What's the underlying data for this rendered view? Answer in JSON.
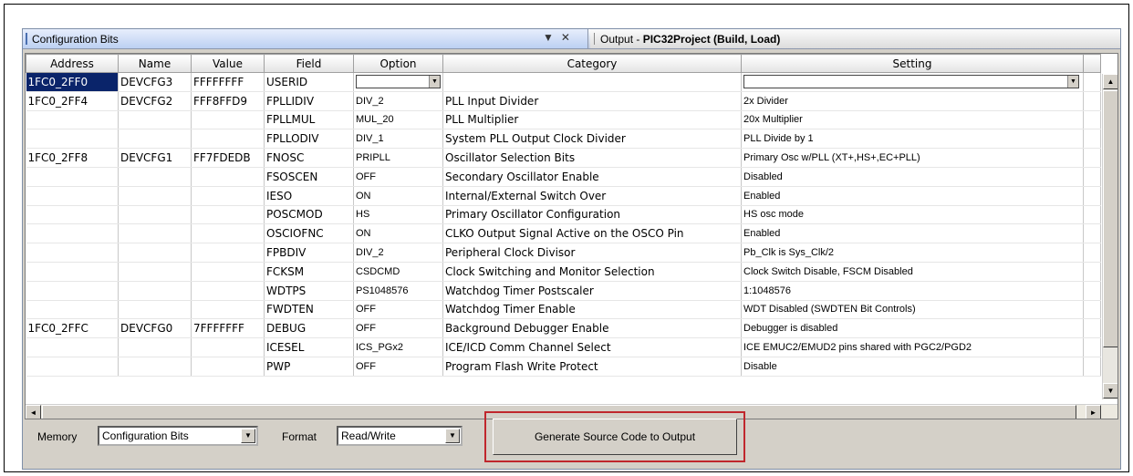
{
  "panel": {
    "title": "Configuration Bits",
    "pin_icon": "▼",
    "close_icon": "✕",
    "output_tab_prefix": "Output - ",
    "output_tab_bold": "PIC32Project (Build, Load)"
  },
  "table": {
    "columns": [
      "Address",
      "Name",
      "Value",
      "Field",
      "Option",
      "Category",
      "Setting"
    ],
    "rows": [
      {
        "address": "1FC0_2FF0",
        "name": "DEVCFG3",
        "value": "FFFFFFFF",
        "field": "USERID",
        "option": "",
        "category": "",
        "setting": "",
        "editing": true
      },
      {
        "address": "1FC0_2FF4",
        "name": "DEVCFG2",
        "value": "FFF8FFD9",
        "field": "FPLLIDIV",
        "option": "DIV_2",
        "category": "PLL Input Divider",
        "setting": "2x Divider"
      },
      {
        "address": "",
        "name": "",
        "value": "",
        "field": "FPLLMUL",
        "option": "MUL_20",
        "category": "PLL Multiplier",
        "setting": "20x Multiplier"
      },
      {
        "address": "",
        "name": "",
        "value": "",
        "field": "FPLLODIV",
        "option": "DIV_1",
        "category": "System PLL Output Clock Divider",
        "setting": "PLL Divide by 1"
      },
      {
        "address": "1FC0_2FF8",
        "name": "DEVCFG1",
        "value": "FF7FDEDB",
        "field": "FNOSC",
        "option": "PRIPLL",
        "category": "Oscillator Selection Bits",
        "setting": "Primary Osc w/PLL (XT+,HS+,EC+PLL)"
      },
      {
        "address": "",
        "name": "",
        "value": "",
        "field": "FSOSCEN",
        "option": "OFF",
        "category": "Secondary Oscillator Enable",
        "setting": "Disabled"
      },
      {
        "address": "",
        "name": "",
        "value": "",
        "field": "IESO",
        "option": "ON",
        "category": "Internal/External Switch Over",
        "setting": "Enabled"
      },
      {
        "address": "",
        "name": "",
        "value": "",
        "field": "POSCMOD",
        "option": "HS",
        "category": "Primary Oscillator Configuration",
        "setting": "HS osc mode"
      },
      {
        "address": "",
        "name": "",
        "value": "",
        "field": "OSCIOFNC",
        "option": "ON",
        "category": "CLKO Output Signal Active on the OSCO Pin",
        "setting": "Enabled"
      },
      {
        "address": "",
        "name": "",
        "value": "",
        "field": "FPBDIV",
        "option": "DIV_2",
        "category": "Peripheral Clock Divisor",
        "setting": "Pb_Clk is Sys_Clk/2"
      },
      {
        "address": "",
        "name": "",
        "value": "",
        "field": "FCKSM",
        "option": "CSDCMD",
        "category": "Clock Switching and Monitor Selection",
        "setting": "Clock Switch Disable, FSCM Disabled"
      },
      {
        "address": "",
        "name": "",
        "value": "",
        "field": "WDTPS",
        "option": "PS1048576",
        "category": "Watchdog Timer Postscaler",
        "setting": "1:1048576"
      },
      {
        "address": "",
        "name": "",
        "value": "",
        "field": "FWDTEN",
        "option": "OFF",
        "category": "Watchdog Timer Enable",
        "setting": "WDT Disabled (SWDTEN Bit Controls)"
      },
      {
        "address": "1FC0_2FFC",
        "name": "DEVCFG0",
        "value": "7FFFFFFF",
        "field": "DEBUG",
        "option": "OFF",
        "category": "Background Debugger Enable",
        "setting": "Debugger is disabled"
      },
      {
        "address": "",
        "name": "",
        "value": "",
        "field": "ICESEL",
        "option": "ICS_PGx2",
        "category": "ICE/ICD Comm Channel Select",
        "setting": "ICE EMUC2/EMUD2 pins shared with PGC2/PGD2"
      },
      {
        "address": "",
        "name": "",
        "value": "",
        "field": "PWP",
        "option": "OFF",
        "category": "Program Flash Write Protect",
        "setting": "Disable"
      }
    ]
  },
  "scroll": {
    "up": "▲",
    "down": "▼",
    "left": "◄",
    "right": "►"
  },
  "footer": {
    "memory_label": "Memory",
    "memory_value": "Configuration Bits",
    "format_label": "Format",
    "format_value": "Read/Write",
    "dropdown_glyph": "▼",
    "generate_label": "Generate Source Code to Output"
  }
}
